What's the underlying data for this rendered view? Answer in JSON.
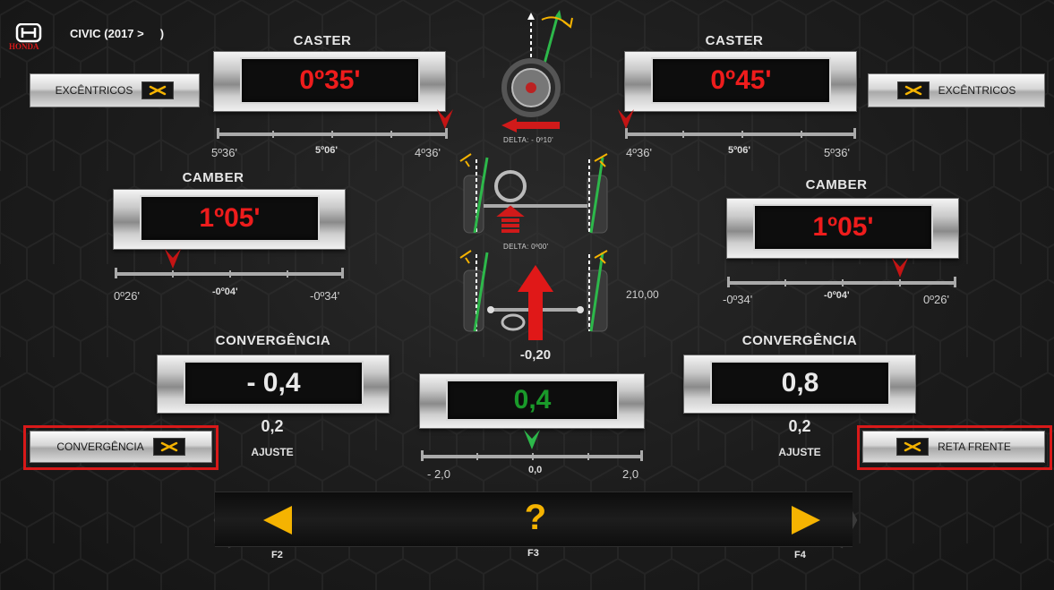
{
  "header": {
    "model": "CIVIC (2017 >     )",
    "brand_text": "HONDA"
  },
  "left": {
    "caster": {
      "title": "CASTER",
      "value": "0º35'",
      "scale_left": "5º36'",
      "scale_mid": "5º06'",
      "scale_right": "4º36'"
    },
    "eccentric_button": "EXCÊNTRICOS",
    "camber": {
      "title": "CAMBER",
      "value": "1º05'",
      "scale_left": "0º26'",
      "scale_mid": "-0º04'",
      "scale_right": "-0º34'"
    },
    "toe": {
      "title": "CONVERGÊNCIA",
      "value": "- 0,4",
      "sub_value": "0,2",
      "adjust_label": "AJUSTE"
    },
    "toe_button": "CONVERGÊNCIA"
  },
  "right": {
    "caster": {
      "title": "CASTER",
      "value": "0º45'",
      "scale_left": "4º36'",
      "scale_mid": "5º06'",
      "scale_right": "5º36'"
    },
    "eccentric_button": "EXCÊNTRICOS",
    "camber": {
      "title": "CAMBER",
      "value": "1º05'",
      "scale_left": "-0º34'",
      "scale_mid": "-0º04'",
      "scale_right": "0º26'"
    },
    "toe": {
      "title": "CONVERGÊNCIA",
      "value": "0,8",
      "sub_value": "0,2",
      "adjust_label": "AJUSTE"
    },
    "straight_button": "RETA FRENTE"
  },
  "center": {
    "caster_delta": "DELTA:  - 0º10'",
    "camber_delta": "DELTA:    0º00'",
    "steering_value": "210,00",
    "thrust_value": "-0,20",
    "total_toe": {
      "value": "0,4",
      "scale_left": "- 2,0",
      "scale_mid": "0,0",
      "scale_right": "2,0"
    }
  },
  "nav": {
    "prev_key": "F2",
    "help_key": "F3",
    "next_key": "F4",
    "help_symbol": "?"
  },
  "colors": {
    "accent": "#f5b301",
    "value_red": "#ee1c1c",
    "value_green": "#1a9a2a",
    "highlight": "#d81919"
  }
}
